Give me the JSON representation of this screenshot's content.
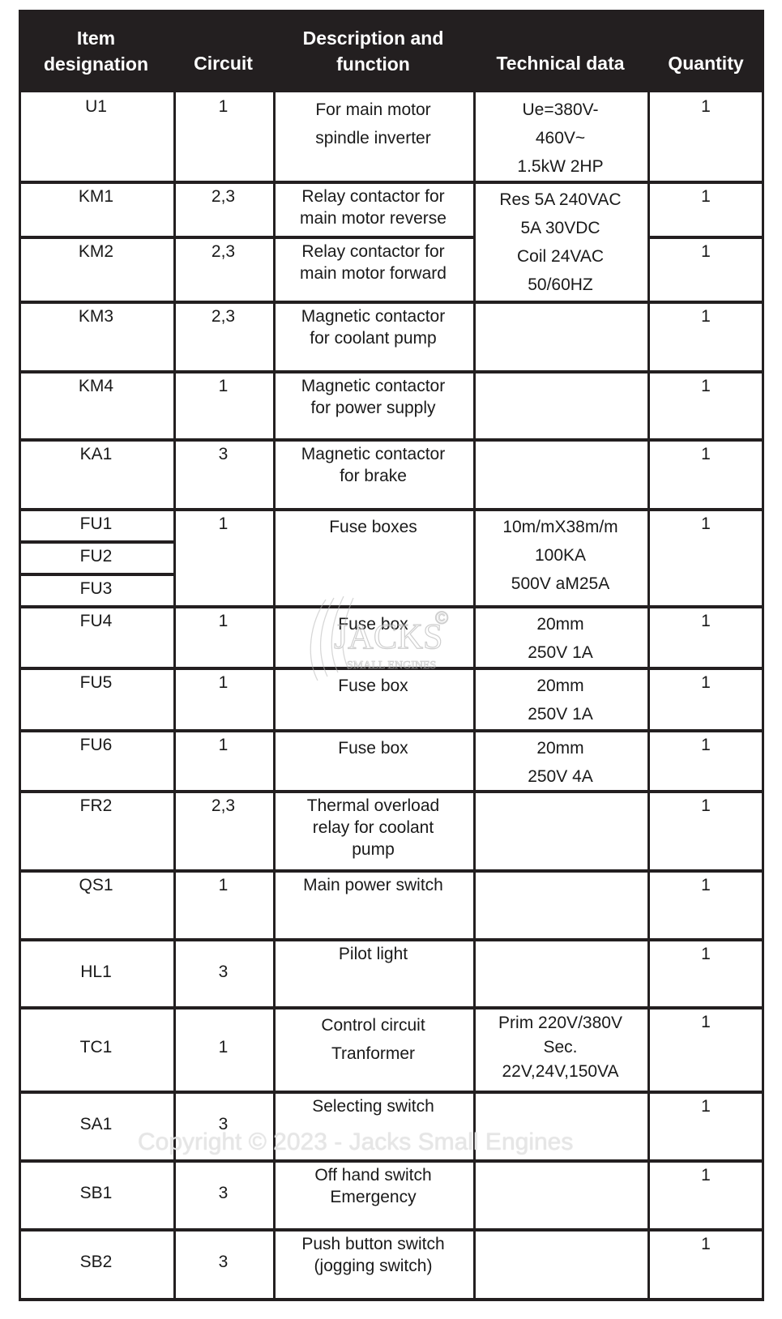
{
  "table": {
    "headers": {
      "item": [
        "Item",
        "designation"
      ],
      "circuit": [
        "Circuit"
      ],
      "description": [
        "Description and",
        "function"
      ],
      "technical": [
        "Technical data"
      ],
      "quantity": [
        "Quantity"
      ]
    },
    "rows": [
      {
        "item": [
          "U1"
        ],
        "circuit": "1",
        "description": [
          "For main motor",
          "spindle inverter"
        ],
        "technical": [
          "Ue=380V-",
          "460V~",
          "1.5kW  2HP"
        ],
        "quantity": "1"
      },
      {
        "item": [
          "KM1"
        ],
        "circuit": "2,3",
        "description": [
          "Relay contactor for",
          "main motor reverse"
        ],
        "technical": [
          "Res 5A 240VAC",
          "5A 30VDC",
          "Coil 24VAC",
          "50/60HZ"
        ],
        "quantity": "1"
      },
      {
        "item": [
          "KM2"
        ],
        "circuit": "2,3",
        "description": [
          "Relay contactor for",
          "main motor forward"
        ],
        "technical": [],
        "quantity": "1"
      },
      {
        "item": [
          "KM3"
        ],
        "circuit": "2,3",
        "description": [
          "Magnetic contactor",
          "for coolant pump"
        ],
        "technical": [],
        "quantity": "1"
      },
      {
        "item": [
          "KM4"
        ],
        "circuit": "1",
        "description": [
          "Magnetic contactor",
          "for power supply"
        ],
        "technical": [],
        "quantity": "1"
      },
      {
        "item": [
          "KA1"
        ],
        "circuit": "3",
        "description": [
          "Magnetic contactor",
          "for brake"
        ],
        "technical": [],
        "quantity": "1"
      },
      {
        "item": [
          "FU1",
          "FU2",
          "FU3"
        ],
        "circuit": "1",
        "description": [
          "Fuse boxes"
        ],
        "technical": [
          "10m/mX38m/m",
          "100KA",
          "500V aM25A"
        ],
        "quantity": "1"
      },
      {
        "item": [
          "FU4"
        ],
        "circuit": "1",
        "description": [
          "Fuse box"
        ],
        "technical": [
          "20mm",
          "250V 1A"
        ],
        "quantity": "1"
      },
      {
        "item": [
          "FU5"
        ],
        "circuit": "1",
        "description": [
          "Fuse box"
        ],
        "technical": [
          "20mm",
          "250V 1A"
        ],
        "quantity": "1"
      },
      {
        "item": [
          "FU6"
        ],
        "circuit": "1",
        "description": [
          "Fuse box"
        ],
        "technical": [
          "20mm",
          "250V 4A"
        ],
        "quantity": "1"
      },
      {
        "item": [
          "FR2"
        ],
        "circuit": "2,3",
        "description": [
          "Thermal overload",
          "relay for coolant",
          "pump"
        ],
        "technical": [],
        "quantity": "1"
      },
      {
        "item": [
          "QS1"
        ],
        "circuit": "1",
        "description": [
          "Main power switch"
        ],
        "technical": [],
        "quantity": "1"
      },
      {
        "item": [
          "HL1"
        ],
        "circuit": "3",
        "description": [
          "Pilot light"
        ],
        "technical": [],
        "quantity": "1"
      },
      {
        "item": [
          "TC1"
        ],
        "circuit": "1",
        "description": [
          "Control circuit",
          "Tranformer"
        ],
        "technical": [
          "Prim 220V/380V",
          "Sec.",
          "22V,24V,150VA"
        ],
        "quantity": "1"
      },
      {
        "item": [
          "SA1"
        ],
        "circuit": "3",
        "description": [
          "Selecting switch"
        ],
        "technical": [],
        "quantity": "1"
      },
      {
        "item": [
          "SB1"
        ],
        "circuit": "3",
        "description": [
          "Off hand switch",
          "Emergency"
        ],
        "technical": [],
        "quantity": "1"
      },
      {
        "item": [
          "SB2"
        ],
        "circuit": "3",
        "description": [
          "Push button switch",
          "(jogging switch)"
        ],
        "technical": [],
        "quantity": "1"
      }
    ]
  },
  "watermarks": {
    "logo_text": "JACKS",
    "logo_subtext": "SMALL ENGINES",
    "logo_symbol": "©",
    "copyright": "Copyright © 2023 - Jacks Small Engines"
  }
}
